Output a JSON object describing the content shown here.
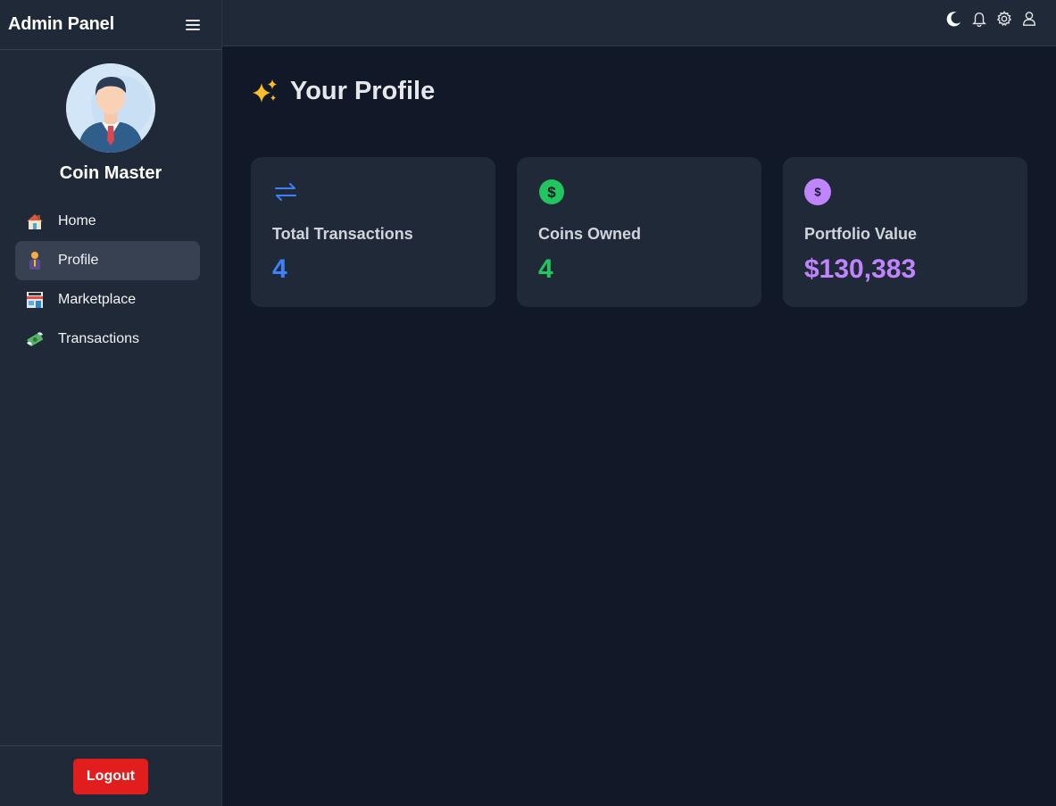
{
  "sidebar": {
    "brand": "Admin Panel",
    "username": "Coin Master",
    "items": [
      {
        "label": "Home",
        "icon": "house-icon"
      },
      {
        "label": "Profile",
        "icon": "person-icon"
      },
      {
        "label": "Marketplace",
        "icon": "store-icon"
      },
      {
        "label": "Transactions",
        "icon": "money-wings-icon"
      }
    ],
    "active_item": "Profile",
    "logout_label": "Logout"
  },
  "topbar": {
    "icons": [
      "moon-icon",
      "bell-icon",
      "gear-icon",
      "user-icon"
    ]
  },
  "main": {
    "title": "Your Profile",
    "title_icon": "sparkles-icon",
    "cards": [
      {
        "label": "Total Transactions",
        "value": "4",
        "icon": "arrows-exchange-icon",
        "color": "#3b82f6"
      },
      {
        "label": "Coins Owned",
        "value": "4",
        "icon": "dollar-circle-icon",
        "color": "#22c55e"
      },
      {
        "label": "Portfolio Value",
        "value": "$130,383",
        "icon": "dollar-circle-icon",
        "color": "#c084fc"
      }
    ]
  },
  "colors": {
    "background": "#111827",
    "panel": "#1f2937",
    "active_nav": "#374151",
    "logout": "#e11d1d",
    "sparkle": "#fbbf24"
  }
}
